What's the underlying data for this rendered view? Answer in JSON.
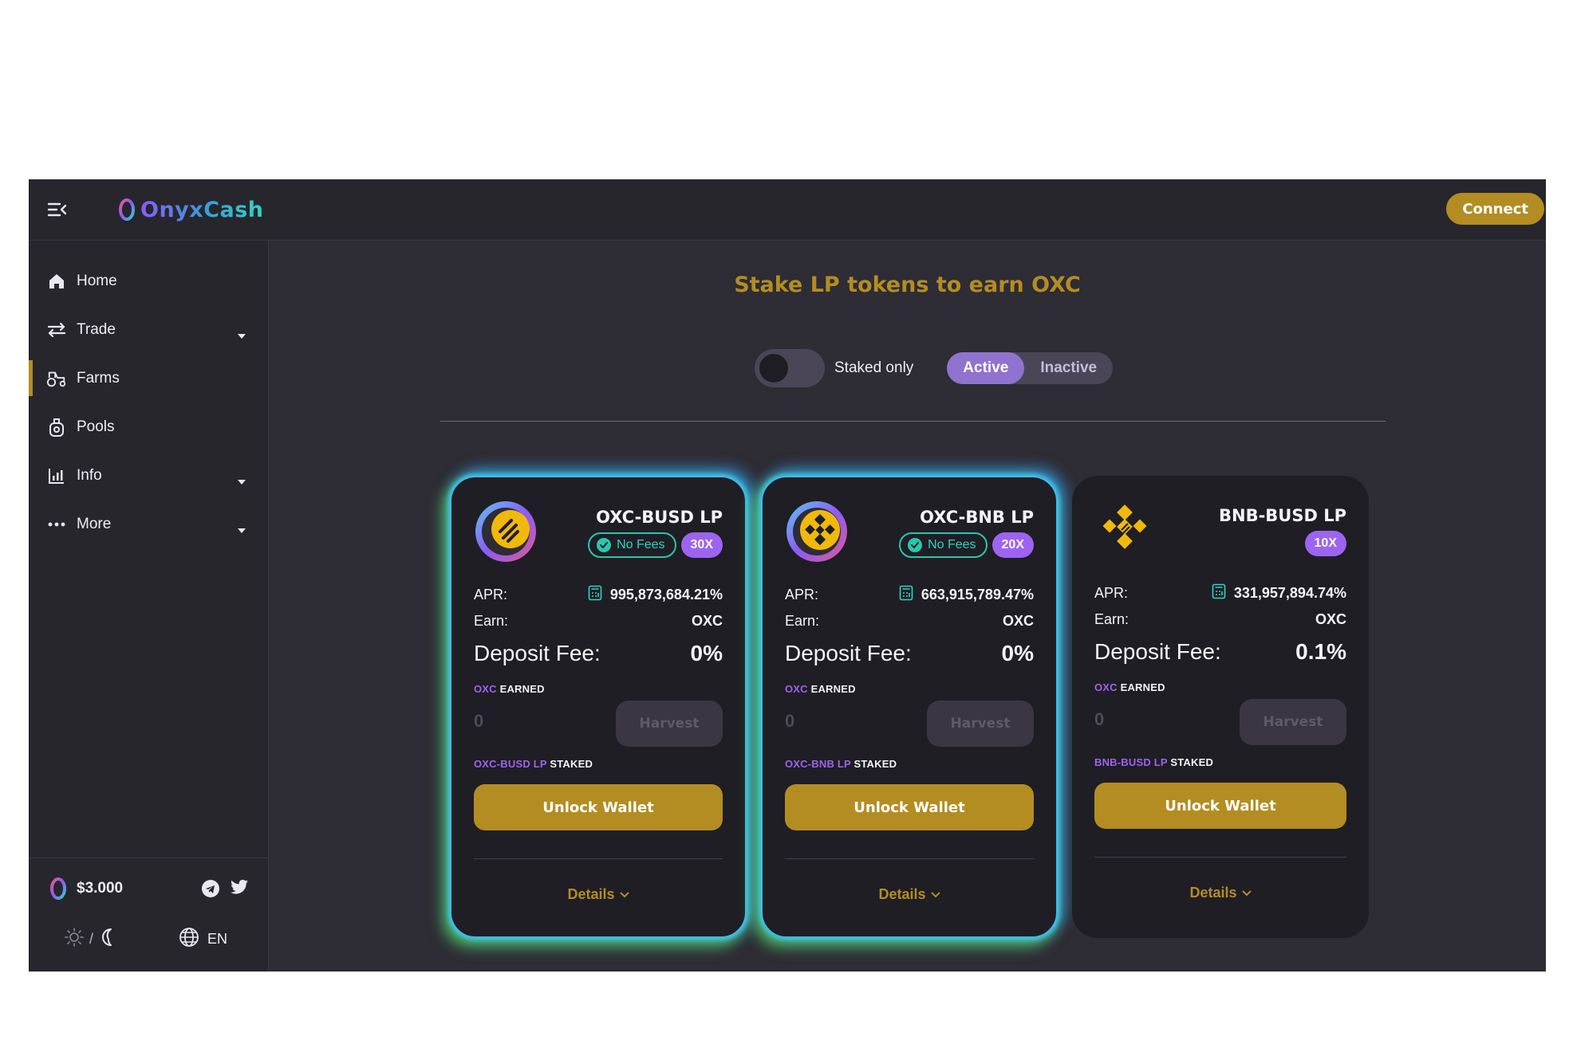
{
  "header": {
    "logo_text": "OnyxCash",
    "connect_label": "Connect"
  },
  "sidebar": {
    "items": [
      {
        "label": "Home",
        "icon": "home-icon"
      },
      {
        "label": "Trade",
        "icon": "swap-icon",
        "has_caret": true
      },
      {
        "label": "Farms",
        "icon": "tractor-icon",
        "active": true
      },
      {
        "label": "Pools",
        "icon": "pool-icon"
      },
      {
        "label": "Info",
        "icon": "chart-icon",
        "has_caret": true
      },
      {
        "label": "More",
        "icon": "dots-icon",
        "has_caret": true
      }
    ],
    "footer": {
      "price": "$3.000",
      "theme_separator": "/",
      "language": "EN"
    }
  },
  "main": {
    "title": "Stake LP tokens to earn OXC",
    "staked_only_label": "Staked only",
    "tabs": [
      "Active",
      "Inactive"
    ],
    "active_tab": "Active"
  },
  "farms": [
    {
      "name": "OXC-BUSD LP",
      "no_fees_label": "No Fees",
      "has_no_fees": true,
      "multiplier": "30X",
      "apr_label": "APR:",
      "apr": "995,873,684.21%",
      "earn_label": "Earn:",
      "earn": "OXC",
      "deposit_fee_label": "Deposit Fee:",
      "deposit_fee": "0%",
      "earned_token": "OXC",
      "earned_suffix": "EARNED",
      "earned_value": "0",
      "harvest_label": "Harvest",
      "staked_token": "OXC-BUSD LP",
      "staked_suffix": "STAKED",
      "unlock_label": "Unlock Wallet",
      "details_label": "Details",
      "glow": true
    },
    {
      "name": "OXC-BNB LP",
      "no_fees_label": "No Fees",
      "has_no_fees": true,
      "multiplier": "20X",
      "apr_label": "APR:",
      "apr": "663,915,789.47%",
      "earn_label": "Earn:",
      "earn": "OXC",
      "deposit_fee_label": "Deposit Fee:",
      "deposit_fee": "0%",
      "earned_token": "OXC",
      "earned_suffix": "EARNED",
      "earned_value": "0",
      "harvest_label": "Harvest",
      "staked_token": "OXC-BNB LP",
      "staked_suffix": "STAKED",
      "unlock_label": "Unlock Wallet",
      "details_label": "Details",
      "glow": true
    },
    {
      "name": "BNB-BUSD LP",
      "no_fees_label": "",
      "has_no_fees": false,
      "multiplier": "10X",
      "apr_label": "APR:",
      "apr": "331,957,894.74%",
      "earn_label": "Earn:",
      "earn": "OXC",
      "deposit_fee_label": "Deposit Fee:",
      "deposit_fee": "0.1%",
      "earned_token": "OXC",
      "earned_suffix": "EARNED",
      "earned_value": "0",
      "harvest_label": "Harvest",
      "staked_token": "BNB-BUSD LP",
      "staked_suffix": "STAKED",
      "unlock_label": "Unlock Wallet",
      "details_label": "Details",
      "glow": false
    }
  ],
  "colors": {
    "accent_gold": "#b38d22",
    "purple": "#9c64f0",
    "teal": "#2fd3c4"
  }
}
